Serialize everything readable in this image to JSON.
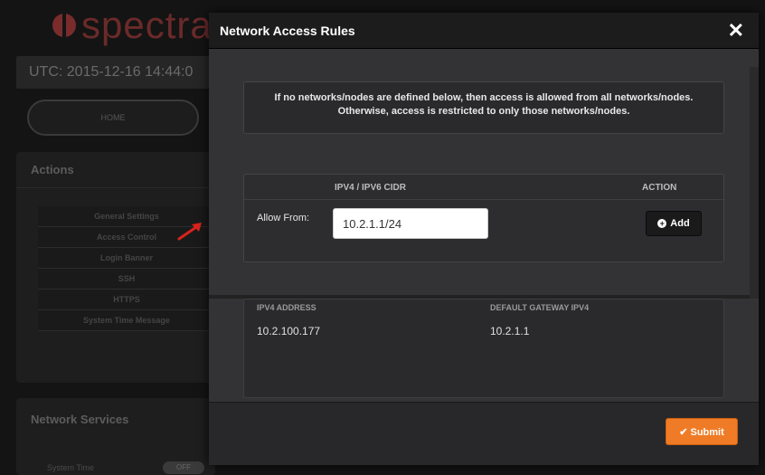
{
  "background": {
    "logo_text": "spectra",
    "utc": "UTC: 2015-12-16 14:44:0",
    "home_label": "HOME",
    "actions": {
      "title": "Actions",
      "items": [
        "General Settings",
        "Access Control",
        "Login Banner",
        "SSH",
        "HTTPS",
        "System Time Message"
      ]
    },
    "network_services": {
      "title": "Network Services",
      "system_time_label": "System Time",
      "toggle_label": "OFF"
    }
  },
  "modal": {
    "title": "Network Access Rules",
    "close_label": "✕",
    "info": "If no networks/nodes are defined below, then access is allowed from all networks/nodes. Otherwise, access is restricted to only those networks/nodes.",
    "rules": {
      "col_cidr": "IPV4 / IPV6 CIDR",
      "col_action": "ACTION",
      "allow_label": "Allow From:",
      "cidr_value": "10.2.1.1/24",
      "add_label": "Add"
    },
    "ip_info": {
      "ip_header": "IPV4 ADDRESS",
      "gw_header": "DEFAULT GATEWAY IPV4",
      "ip_value": "10.2.100.177",
      "gw_value": "10.2.1.1"
    },
    "submit_label": "✔ Submit"
  },
  "colors": {
    "accent_orange": "#f07b26",
    "arrow_red": "#d9231c"
  }
}
